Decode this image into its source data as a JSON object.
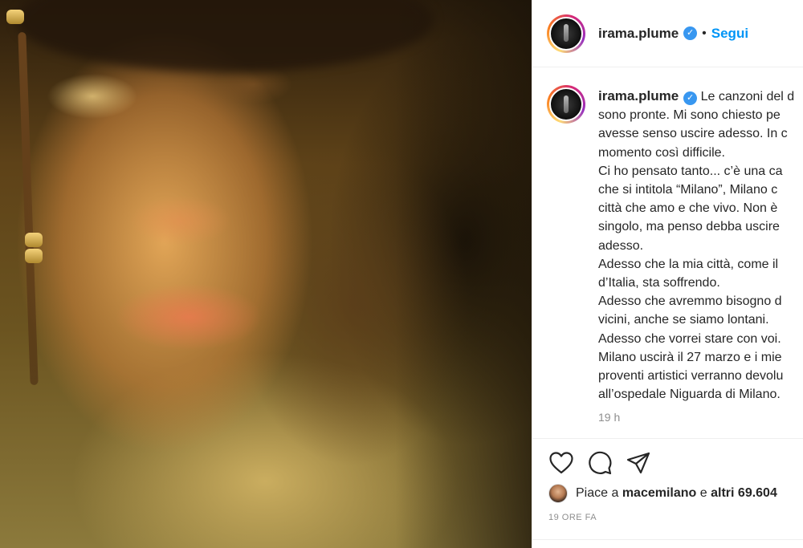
{
  "post": {
    "author": "irama.plume",
    "separator": "•",
    "follow_label": "Segui",
    "caption_lines": [
      "Le canzoni del d",
      "sono pronte. Mi sono chiesto pe",
      "avesse senso uscire adesso. In c",
      "momento così difficile.",
      "Ci ho pensato tanto... c’è una ca",
      "che si intitola “Milano”, Milano c",
      "città che amo e che vivo. Non è",
      "singolo, ma penso debba uscire",
      "adesso.",
      "Adesso che la mia città, come il",
      "d’Italia, sta soffrendo.",
      "Adesso che avremmo bisogno d",
      "vicini, anche se siamo lontani.",
      "Adesso che vorrei stare con voi.",
      "Milano uscirà il 27 marzo e i mie",
      "proventi artistici verranno devolu",
      "all’ospedale Niguarda di Milano."
    ],
    "caption_age": "19 h",
    "likes": {
      "prefix": "Piace a",
      "user": "macemilano",
      "conj": "e",
      "others": "altri 69.604"
    },
    "posted_ago": "19 ORE FA"
  },
  "icons": {
    "like": "heart-icon",
    "comment": "comment-icon",
    "share": "paper-plane-icon",
    "verified": "verified-badge-icon"
  },
  "colors": {
    "follow_blue": "#0095f6",
    "verified_blue": "#3897f0",
    "muted_text": "#8e8e8e"
  }
}
